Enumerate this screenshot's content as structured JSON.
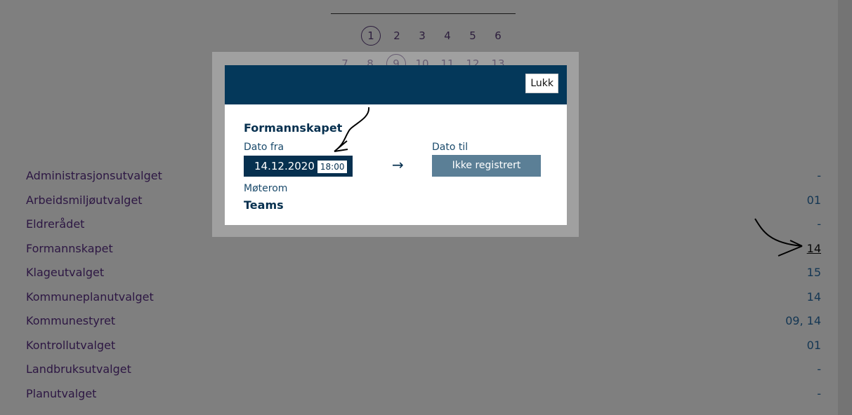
{
  "pager": {
    "row1": [
      "1",
      "2",
      "3",
      "4",
      "5",
      "6"
    ],
    "row1_current": "1",
    "row2": [
      "7",
      "8",
      "9",
      "10",
      "11",
      "12",
      "13"
    ],
    "row2_current": "9"
  },
  "committees": [
    {
      "name": "Administrasjonsutvalget",
      "value": "-"
    },
    {
      "name": "Arbeidsmiljøutvalget",
      "value": "01"
    },
    {
      "name": "Eldrerådet",
      "value": "-"
    },
    {
      "name": "Formannskapet",
      "value": "14"
    },
    {
      "name": "Klageutvalget",
      "value": "15"
    },
    {
      "name": "Kommuneplanutvalget",
      "value": "14"
    },
    {
      "name": "Kommunestyret",
      "value": "09, 14"
    },
    {
      "name": "Kontrollutvalget",
      "value": "01"
    },
    {
      "name": "Landbruksutvalget",
      "value": "-"
    },
    {
      "name": "Planutvalget",
      "value": "-"
    }
  ],
  "modal": {
    "close_label": "Lukk",
    "title": "Formannskapet",
    "from_label": "Dato fra",
    "from_date": "14.12.2020",
    "from_time": "18:00",
    "arrow": "→",
    "to_label": "Dato til",
    "to_status": "Ikke registrert",
    "room_label": "Møterom",
    "room_value": "Teams"
  },
  "colors": {
    "header": "#04385a",
    "status_button": "#5b7f96",
    "committee_text": "#5a2e86",
    "value_text": "#2a6fa8"
  }
}
